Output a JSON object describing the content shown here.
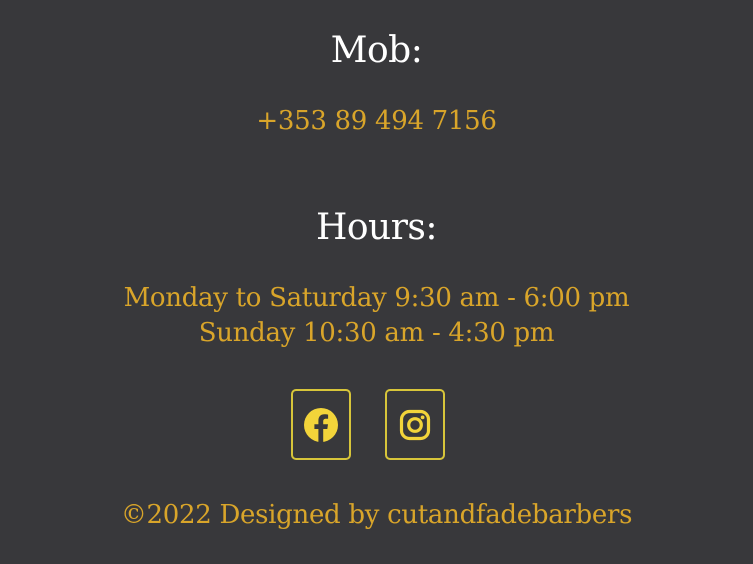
{
  "contact": {
    "mob_heading": "Mob:",
    "mob_number": "+353 89 494 7156"
  },
  "hours": {
    "heading": "Hours:",
    "line1": "Monday to Saturday 9:30 am - 6:00 pm",
    "line2": "Sunday 10:30 am - 4:30 pm"
  },
  "social": {
    "links": [
      {
        "name": "facebook",
        "icon": "facebook-icon"
      },
      {
        "name": "instagram",
        "icon": "instagram-icon"
      }
    ]
  },
  "footer": {
    "copyright": "©2022 Designed by cutandfadebarbers"
  },
  "colors": {
    "background": "#38383b",
    "heading": "#ffffff",
    "accent_text": "#d9a52a",
    "icon_yellow": "#f2d43a"
  }
}
